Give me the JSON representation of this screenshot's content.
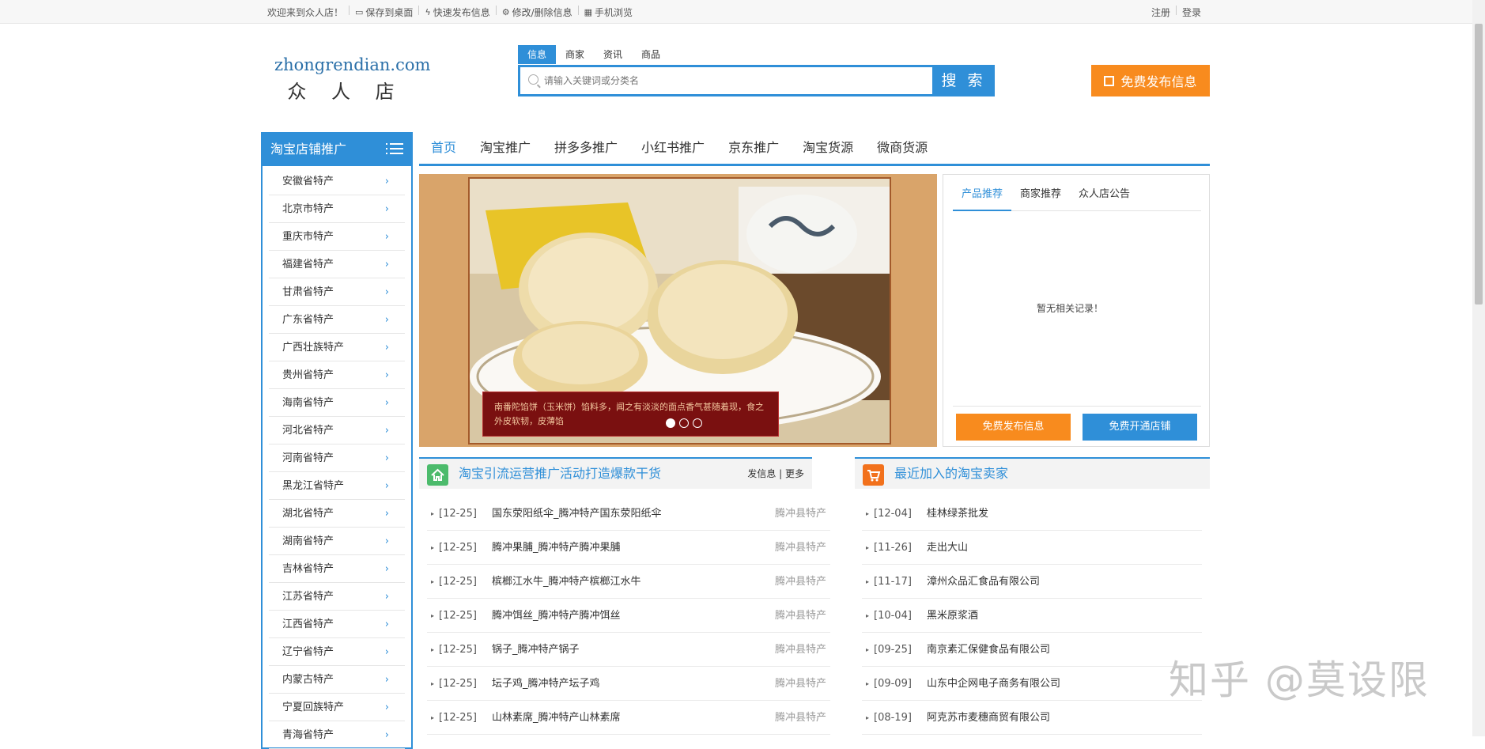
{
  "topbar": {
    "welcome": "欢迎来到众人店！",
    "links": [
      "保存到桌面",
      "快速发布信息",
      "修改/删除信息",
      "手机浏览"
    ],
    "register": "注册",
    "login": "登录"
  },
  "logo": {
    "en": "zhongrendian.com",
    "cn": "众 人 店"
  },
  "search": {
    "tabs": [
      "信息",
      "商家",
      "资讯",
      "商品"
    ],
    "placeholder": "请输入关键词或分类名",
    "button": "搜 索"
  },
  "publish_button": "免费发布信息",
  "sidebar": {
    "title": "淘宝店铺推广",
    "items": [
      "安徽省特产",
      "北京市特产",
      "重庆市特产",
      "福建省特产",
      "甘肃省特产",
      "广东省特产",
      "广西壮族特产",
      "贵州省特产",
      "海南省特产",
      "河北省特产",
      "河南省特产",
      "黑龙江省特产",
      "湖北省特产",
      "湖南省特产",
      "吉林省特产",
      "江苏省特产",
      "江西省特产",
      "辽宁省特产",
      "内蒙古特产",
      "宁夏回族特产",
      "青海省特产"
    ]
  },
  "nav": [
    "首页",
    "淘宝推广",
    "拼多多推广",
    "小红书推广",
    "京东推广",
    "淘宝货源",
    "微商货源"
  ],
  "banner": {
    "caption": "南番陀馅饼（玉米饼）馅料多，闻之有淡淡的面点香气甚随着现，食之外皮软韧，皮薄馅"
  },
  "right_panel": {
    "tabs": [
      "产品推荐",
      "商家推荐",
      "众人店公告"
    ],
    "empty": "暂无相关记录！",
    "btn1": "免费发布信息",
    "btn2": "免费开通店铺"
  },
  "section1": {
    "title": "淘宝引流运营推广活动打造爆款干货",
    "more": "发信息 | 更多",
    "rows": [
      {
        "date": "[12-25]",
        "text": "国东荥阳纸伞_腾冲特产国东荥阳纸伞",
        "cat": "腾冲县特产"
      },
      {
        "date": "[12-25]",
        "text": "腾冲果脯_腾冲特产腾冲果脯",
        "cat": "腾冲县特产"
      },
      {
        "date": "[12-25]",
        "text": "槟榔江水牛_腾冲特产槟榔江水牛",
        "cat": "腾冲县特产"
      },
      {
        "date": "[12-25]",
        "text": "腾冲饵丝_腾冲特产腾冲饵丝",
        "cat": "腾冲县特产"
      },
      {
        "date": "[12-25]",
        "text": "锅子_腾冲特产锅子",
        "cat": "腾冲县特产"
      },
      {
        "date": "[12-25]",
        "text": "坛子鸡_腾冲特产坛子鸡",
        "cat": "腾冲县特产"
      },
      {
        "date": "[12-25]",
        "text": "山林素席_腾冲特产山林素席",
        "cat": "腾冲县特产"
      }
    ]
  },
  "section2": {
    "title": "最近加入的淘宝卖家",
    "rows": [
      {
        "date": "[12-04]",
        "text": "桂林绿茶批发"
      },
      {
        "date": "[11-26]",
        "text": "走出大山"
      },
      {
        "date": "[11-17]",
        "text": "漳州众品汇食品有限公司"
      },
      {
        "date": "[10-04]",
        "text": "黑米原浆酒"
      },
      {
        "date": "[09-25]",
        "text": "南京素汇保健食品有限公司"
      },
      {
        "date": "[09-09]",
        "text": "山东中企网电子商务有限公司"
      },
      {
        "date": "[08-19]",
        "text": "阿克苏市麦穗商贸有限公司"
      }
    ]
  },
  "watermark": "知乎 @莫设限",
  "colors": {
    "accent": "#2f8fd8",
    "orange": "#f88b1e"
  }
}
